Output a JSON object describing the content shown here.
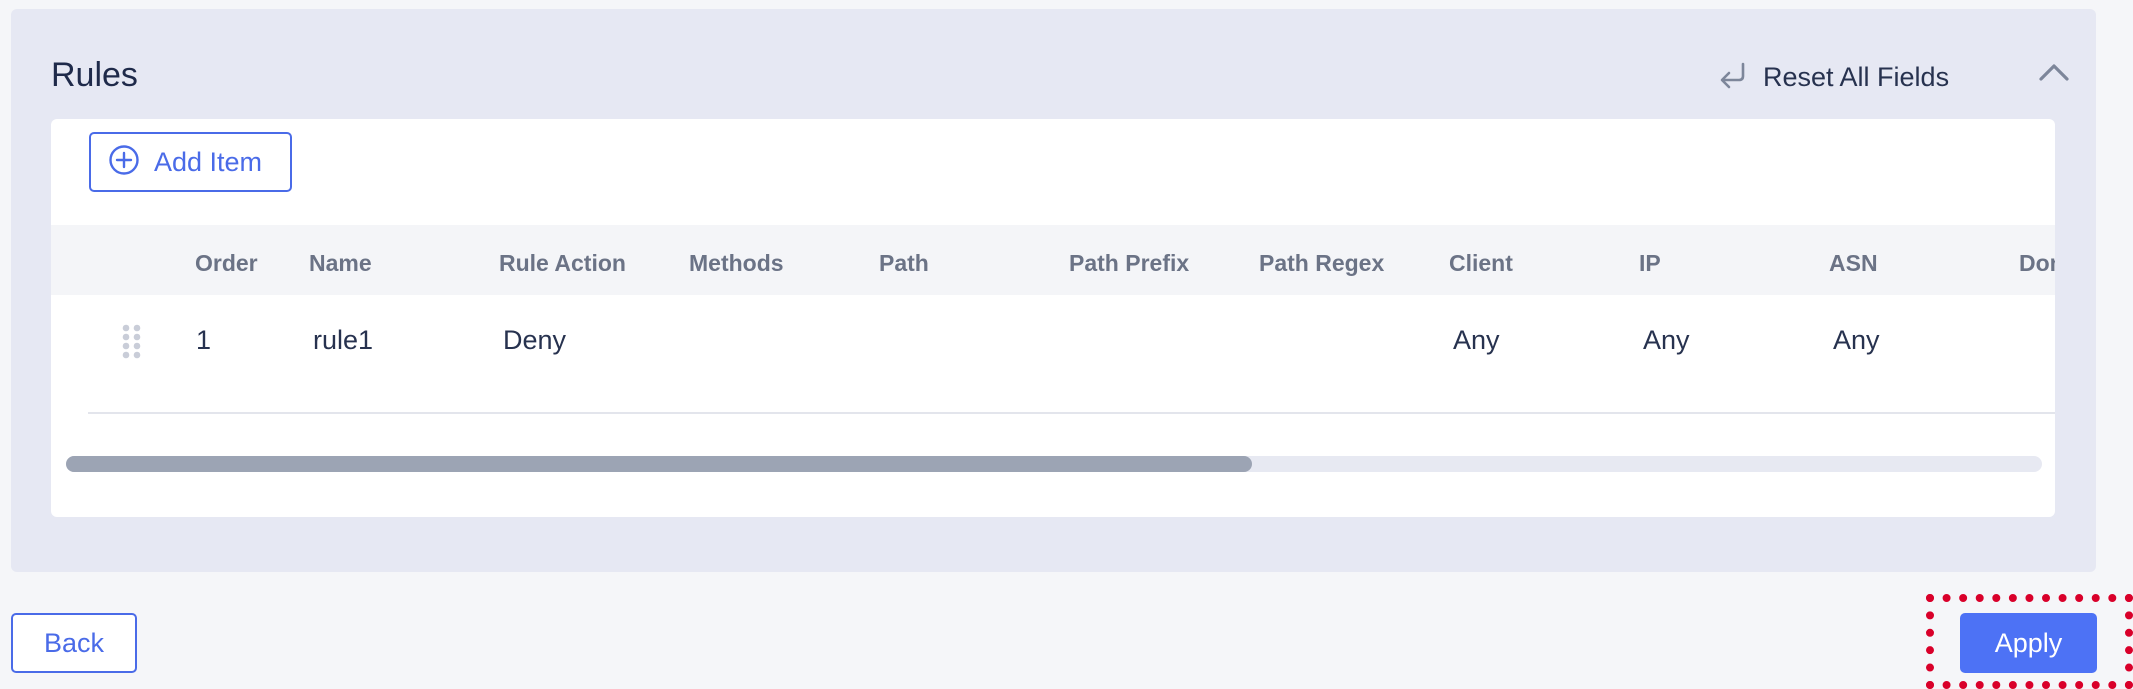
{
  "panel": {
    "title": "Rules",
    "reset_label": "Reset All Fields",
    "reset_icon": "undo-arrow-icon",
    "collapse_icon": "chevron-up-icon"
  },
  "toolbar": {
    "add_item_label": "Add Item",
    "add_item_icon": "plus-circle-icon"
  },
  "table": {
    "columns": [
      "Order",
      "Name",
      "Rule Action",
      "Methods",
      "Path",
      "Path Prefix",
      "Path Regex",
      "Client",
      "IP",
      "ASN",
      "Dom"
    ],
    "rows": [
      {
        "order": "1",
        "name": "rule1",
        "rule_action": "Deny",
        "methods": "",
        "path": "",
        "path_prefix": "",
        "path_regex": "",
        "client": "Any",
        "ip": "Any",
        "asn": "Any"
      }
    ],
    "scroll_fraction": 0.6
  },
  "footer": {
    "back_label": "Back",
    "apply_label": "Apply"
  },
  "colors": {
    "accent": "#4a6be8",
    "primary_button": "#4d72f5",
    "highlight": "#d9002a",
    "panel_bg": "#e6e8f3"
  }
}
